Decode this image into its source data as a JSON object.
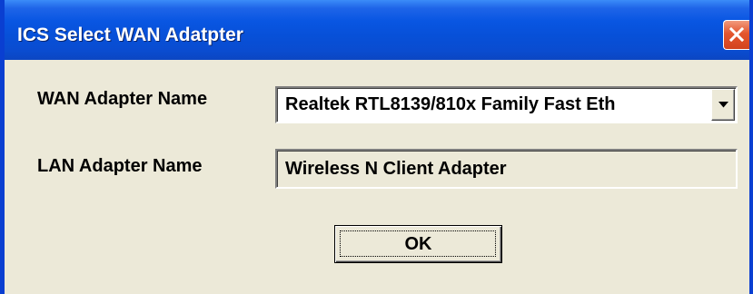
{
  "window": {
    "title": "ICS Select WAN Adatpter",
    "title_bar_color": "#0a4cd0",
    "close_button_color": "#e4562e"
  },
  "form": {
    "wan_label": "WAN Adapter Name",
    "wan_selected": "Realtek RTL8139/810x Family Fast Eth",
    "lan_label": "LAN Adapter Name",
    "lan_value": "Wireless N Client Adapter"
  },
  "buttons": {
    "ok_label": "OK"
  },
  "icons": {
    "close": "close-icon",
    "dropdown": "chevron-down-icon"
  }
}
